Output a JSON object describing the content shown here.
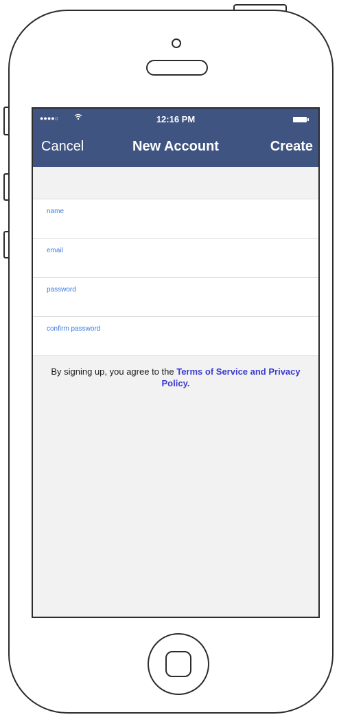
{
  "status_bar": {
    "signal": "●●●●○",
    "wifi_icon": "wifi-icon",
    "time": "12:16 PM",
    "battery_icon": "battery-icon"
  },
  "navbar": {
    "cancel_label": "Cancel",
    "title": "New Account",
    "create_label": "Create",
    "background_color": "#3f5480"
  },
  "form": {
    "fields": [
      {
        "label": "name",
        "value": ""
      },
      {
        "label": "email",
        "value": ""
      },
      {
        "label": "password",
        "value": ""
      },
      {
        "label": "confirm password",
        "value": ""
      }
    ],
    "label_color": "#3d7be0"
  },
  "terms": {
    "prefix": "By signing up, you agree to the ",
    "link_text": "Terms of Service and Privacy Policy",
    "suffix": ".",
    "link_color": "#3b3bd0"
  }
}
